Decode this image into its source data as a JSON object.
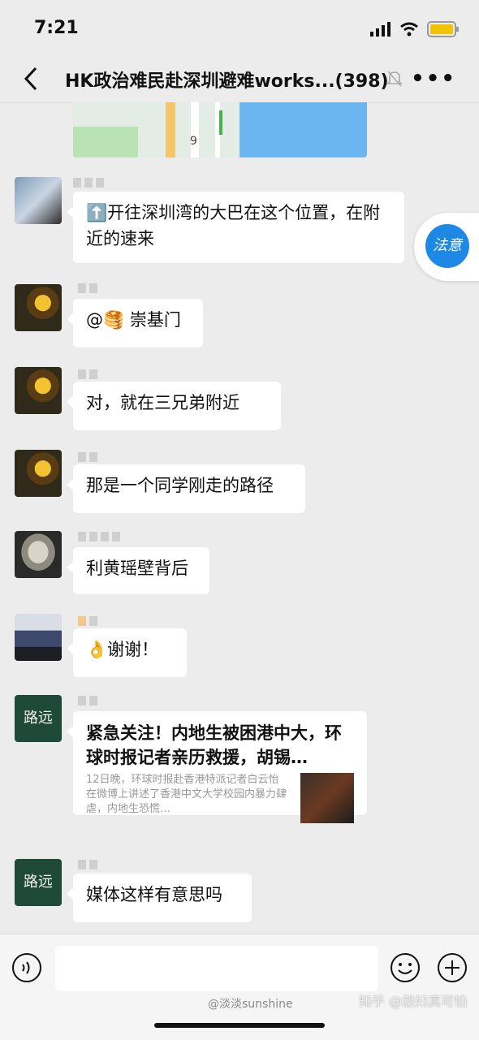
{
  "status": {
    "time": "7:21"
  },
  "header": {
    "title": "HK政治难民赴深圳避难works...(398)"
  },
  "map": {
    "road_label": "9"
  },
  "float_badge": {
    "label": "法意"
  },
  "messages": [
    {
      "text": "开往深圳湾的大巴在这个位置，在附近的速来",
      "emoji": "⬆️"
    },
    {
      "prefix": "@",
      "emoji": "🥞",
      "text": " 崇基门"
    },
    {
      "text": "对，就在三兄弟附近"
    },
    {
      "text": "那是一个同学刚走的路径"
    },
    {
      "text": "利黄瑶壁背后"
    },
    {
      "emoji": "👌",
      "text": "谢谢！"
    },
    {
      "type": "link",
      "title": "紧急关注！内地生被困港中大，环球时报记者亲历救援，胡锡…",
      "description": "12日晚，环球时报赴香港特派记者白云怡在微博上讲述了香港中文大学校园内暴力肆虐，内地生恐慌…"
    },
    {
      "text": "媒体这样有意思吗"
    }
  ],
  "avatar_text": {
    "lu_yuan": "路远"
  },
  "watermarks": {
    "weibo": "@淡淡sunshine",
    "zhihu": "知乎 @怨妇真可怕"
  }
}
